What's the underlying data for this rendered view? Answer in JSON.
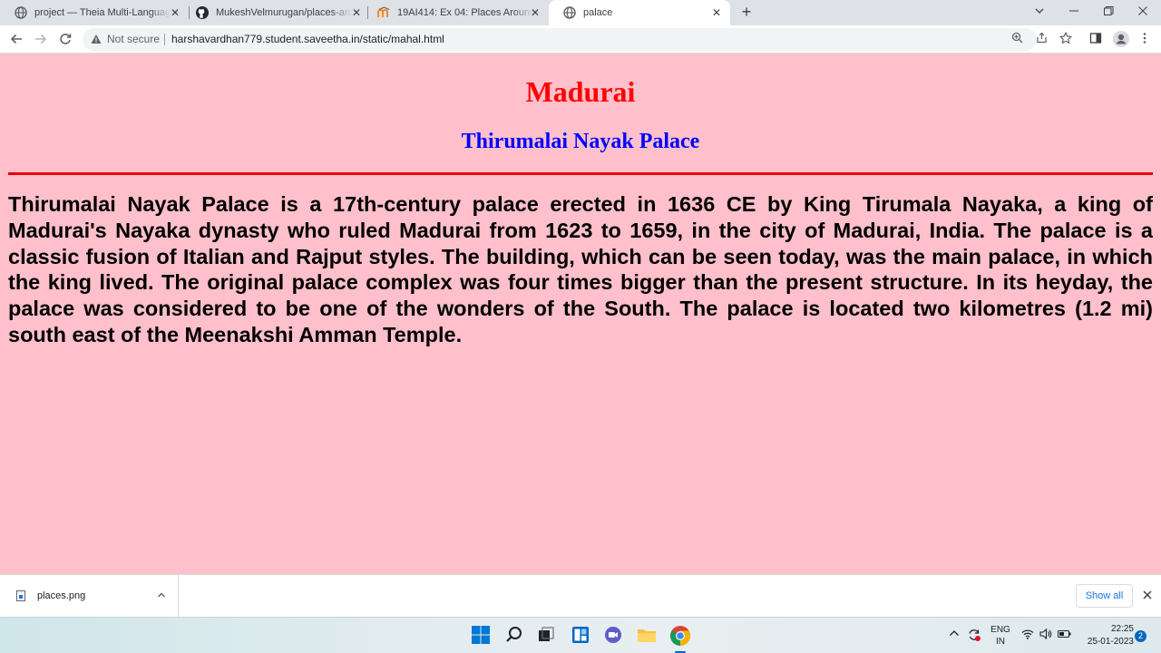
{
  "browser": {
    "tabs": [
      {
        "title": "project — Theia Multi-Language",
        "icon": "globe-icon",
        "active": false
      },
      {
        "title": "MukeshVelmurugan/places-arou",
        "icon": "github-icon",
        "active": false
      },
      {
        "title": "19AI414: Ex 04: Places Around M",
        "icon": "moodle-icon",
        "active": false
      },
      {
        "title": "palace",
        "icon": "globe-icon",
        "active": true
      }
    ],
    "security_label": "Not secure",
    "url": "harshavardhan779.student.saveetha.in/static/mahal.html"
  },
  "page": {
    "heading": "Madurai",
    "subheading": "Thirumalai Nayak Palace",
    "paragraph": "Thirumalai Nayak Palace is a 17th-century palace erected in 1636 CE by King Tirumala Nayaka, a king of Madurai's Nayaka dynasty who ruled Madurai from 1623 to 1659, in the city of Madurai, India. The palace is a classic fusion of Italian and Rajput styles. The building, which can be seen today, was the main palace, in which the king lived. The original palace complex was four times bigger than the present structure. In its heyday, the palace was considered to be one of the wonders of the South. The palace is located two kilometres (1.2 mi) south east of the Meenakshi Amman Temple.",
    "colors": {
      "background": "#ffc0cb",
      "heading": "#ff0000",
      "subheading": "#0000ff",
      "rule": "#ee0000"
    }
  },
  "downloads": {
    "file_name": "places.png",
    "show_all_label": "Show all"
  },
  "taskbar": {
    "language_line1": "ENG",
    "language_line2": "IN",
    "time": "22:25",
    "date": "25-01-2023",
    "notification_count": "2"
  }
}
